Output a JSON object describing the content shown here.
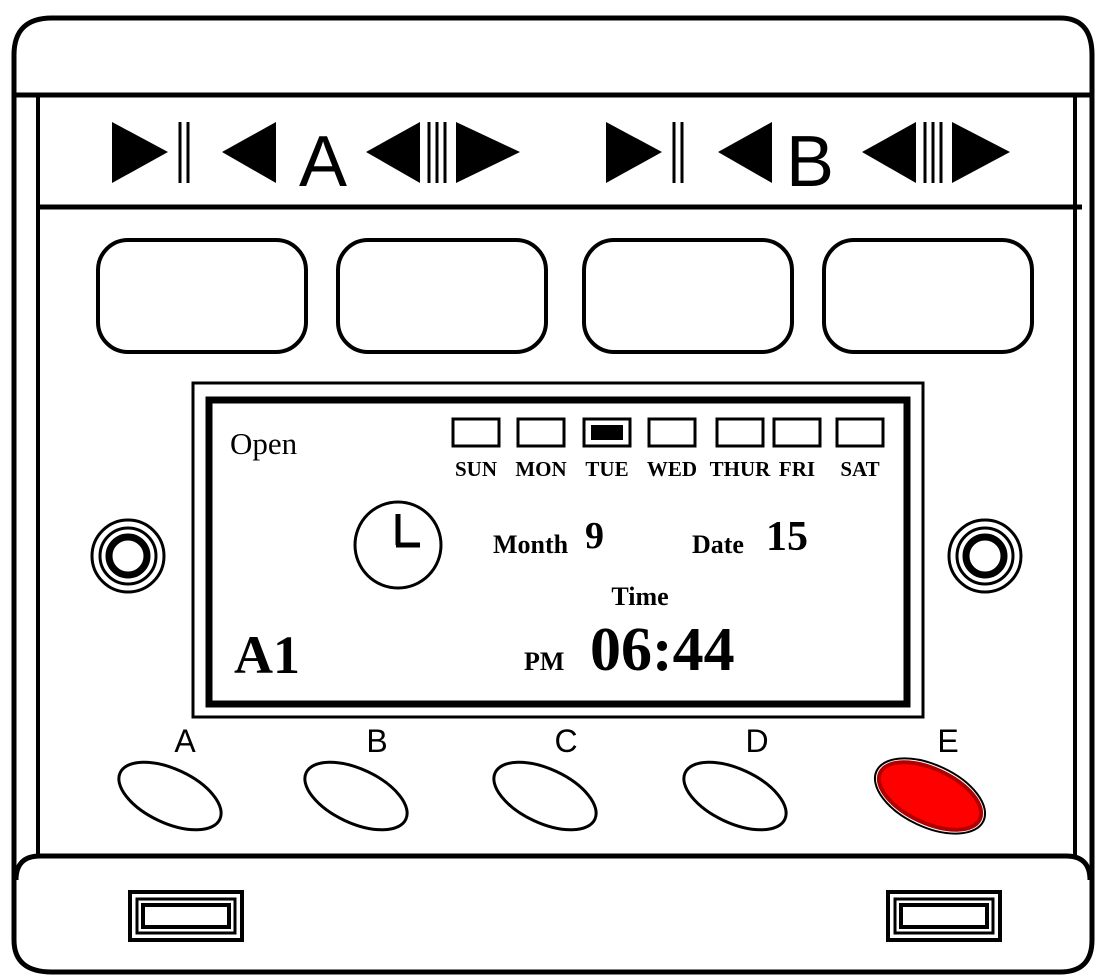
{
  "channels": {
    "a": {
      "label": "A"
    },
    "b": {
      "label": "B"
    }
  },
  "display": {
    "status": "Open",
    "days": [
      {
        "label": "SUN",
        "active": false
      },
      {
        "label": "MON",
        "active": false
      },
      {
        "label": "TUE",
        "active": true
      },
      {
        "label": "WED",
        "active": false
      },
      {
        "label": "THUR",
        "active": false
      },
      {
        "label": "FRI",
        "active": false
      },
      {
        "label": "SAT",
        "active": false
      }
    ],
    "clock_icon": "clock-icon",
    "month_label": "Month",
    "month_value": "9",
    "date_label": "Date",
    "date_value": "15",
    "time_label": "Time",
    "ampm": "PM",
    "time_value": "06:44",
    "program": "A1"
  },
  "buttons": [
    {
      "label": "A",
      "color": "#ffffff"
    },
    {
      "label": "B",
      "color": "#ffffff"
    },
    {
      "label": "C",
      "color": "#ffffff"
    },
    {
      "label": "D",
      "color": "#ffffff"
    },
    {
      "label": "E",
      "color": "#ff0000"
    }
  ],
  "colors": {
    "outline": "#000000",
    "active_button": "#ff0000",
    "background": "#ffffff"
  }
}
